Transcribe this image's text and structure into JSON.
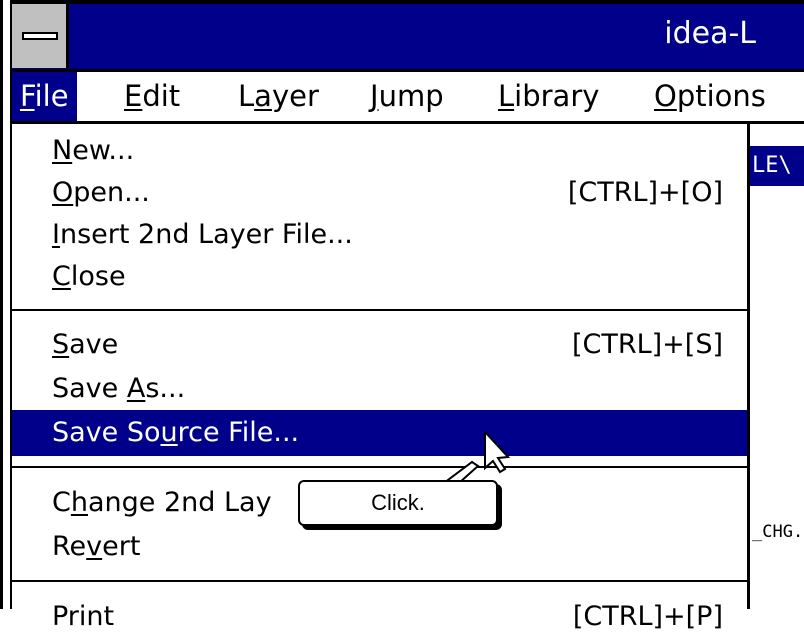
{
  "window": {
    "title": "idea-L"
  },
  "menubar": {
    "items": [
      {
        "pre": "",
        "u": "F",
        "post": "ile",
        "active": true
      },
      {
        "pre": "",
        "u": "E",
        "post": "dit"
      },
      {
        "pre": "L",
        "u": "a",
        "post": "yer"
      },
      {
        "pre": "",
        "u": "J",
        "post": "ump"
      },
      {
        "pre": "",
        "u": "L",
        "post": "ibrary"
      },
      {
        "pre": "",
        "u": "O",
        "post": "ptions"
      }
    ]
  },
  "file_menu": {
    "new": {
      "pre": "",
      "u": "N",
      "post": "ew..."
    },
    "open": {
      "pre": "",
      "u": "O",
      "post": "pen...",
      "shortcut": "[CTRL]+[O]"
    },
    "insert": {
      "pre": "",
      "u": "I",
      "post": "nsert 2nd Layer File..."
    },
    "close": {
      "pre": "",
      "u": "C",
      "post": "lose"
    },
    "save": {
      "pre": "",
      "u": "S",
      "post": "ave",
      "shortcut": "[CTRL]+[S]"
    },
    "save_as": {
      "pre": "Save ",
      "u": "A",
      "post": "s..."
    },
    "save_source": {
      "pre": "Save So",
      "u": "u",
      "post": "rce File..."
    },
    "change_2nd": {
      "pre": "C",
      "u": "h",
      "post": "ange 2nd Lay",
      "tail": "..."
    },
    "revert": {
      "pre": "Re",
      "u": "v",
      "post": "ert"
    },
    "print": {
      "pre": "",
      "u": "",
      "post": "Print",
      "shortcut": "[CTRL]+[P]"
    }
  },
  "document": {
    "strip_text": "LE\\",
    "body_text": "_CHG."
  },
  "callout": {
    "text": "Click."
  }
}
